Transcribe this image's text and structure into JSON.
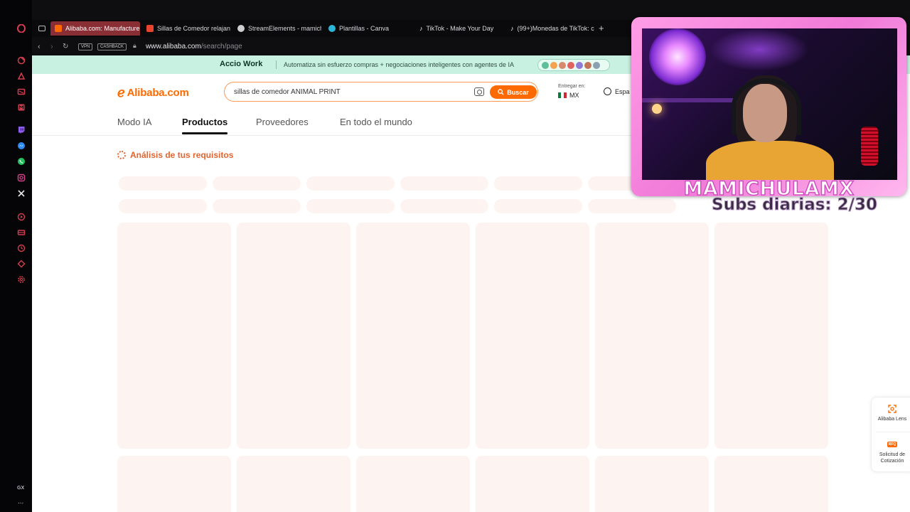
{
  "browser": {
    "tabs": [
      {
        "label": "Alibaba.com: Manufacturer",
        "favicon_color": "#ff6a00",
        "active": true
      },
      {
        "label": "Sillas de Comedor relajante",
        "favicon_color": "#e8432f",
        "active": false
      },
      {
        "label": "StreamElements - mamich",
        "favicon_color": "#cfcfcf",
        "active": false
      },
      {
        "label": "Plantillas - Canva",
        "favicon_color": "#2bb6d8",
        "active": false
      },
      {
        "label": "TikTok - Make Your Day",
        "favicon_color": "#ffffff",
        "active": false
      },
      {
        "label": "(99+)Monedas de TikTok: c",
        "favicon_color": "#ffffff",
        "active": false
      }
    ],
    "new_tab": "+",
    "address": {
      "host": "www.alibaba.com",
      "path": "/search/page"
    },
    "vpn_label": "VPN",
    "cashback_label": "CASHBACK",
    "sidebar_footer": "GX",
    "sidebar_more": "..."
  },
  "banner": {
    "title": "Accio Work",
    "text": "Automatiza sin esfuerzo compras + negociaciones inteligentes con agentes de IA",
    "avatar_colors": [
      "#5fbf9a",
      "#f3a24f",
      "#d98a6c",
      "#e26262",
      "#8f7ad8",
      "#c2745a",
      "#8aa0b0"
    ]
  },
  "header": {
    "logo": "Alibaba.com",
    "search_value": "sillas de comedor ANIMAL PRINT",
    "search_button": "Buscar",
    "deliver_label": "Entregar en:",
    "deliver_country": "MX",
    "language": "Espa"
  },
  "nav": {
    "tabs": [
      "Modo IA",
      "Productos",
      "Proveedores",
      "En todo el mundo"
    ],
    "active": "Productos"
  },
  "analysis": {
    "label": "Análisis de tus requisitos"
  },
  "right_rail": {
    "lens": "Alibaba Lens",
    "rfq": "Solicitud de Cotización",
    "rfq_badge": "RFQ"
  },
  "overlay": {
    "streamer_name": "MAMICHULAMX",
    "subs": "Subs diarias: 2/30"
  },
  "colors": {
    "brand": "#ff6a00",
    "skeleton": "#fdf4f1",
    "active_tab": "#8a2e35",
    "banner": "#c9f1e2"
  }
}
